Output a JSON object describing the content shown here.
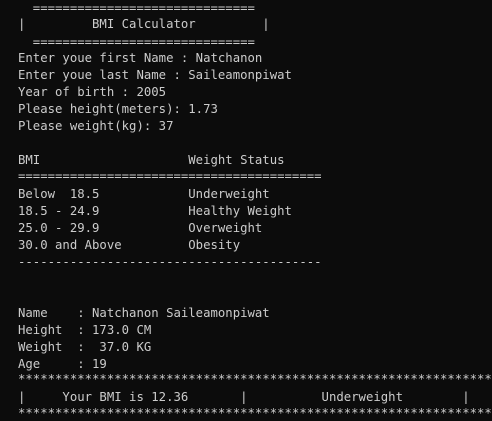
{
  "terminal": {
    "lines": [
      "  ==============================",
      "|         BMI Calculator         |",
      "  ==============================",
      "Enter youe first Name : Natchanon",
      "Enter youe last Name : Saileamonpiwat",
      "Year of birth : 2005",
      "Please height(meters): 1.73",
      "Please weight(kg): 37",
      "",
      "BMI                    Weight Status",
      "=========================================",
      "Below  18.5            Underweight",
      "18.5 - 24.9            Healthy Weight",
      "25.0 - 29.9            Overweight",
      "30.0 and Above         Obesity",
      "-----------------------------------------",
      "",
      "",
      "Name    : Natchanon Saileamonpiwat",
      "Height  : 173.0 CM",
      "Weight  :  37.0 KG",
      "Age     : 19",
      "****************************************************************",
      "|     Your BMI is 12.36       |          Underweight        |",
      "****************************************************************"
    ]
  }
}
